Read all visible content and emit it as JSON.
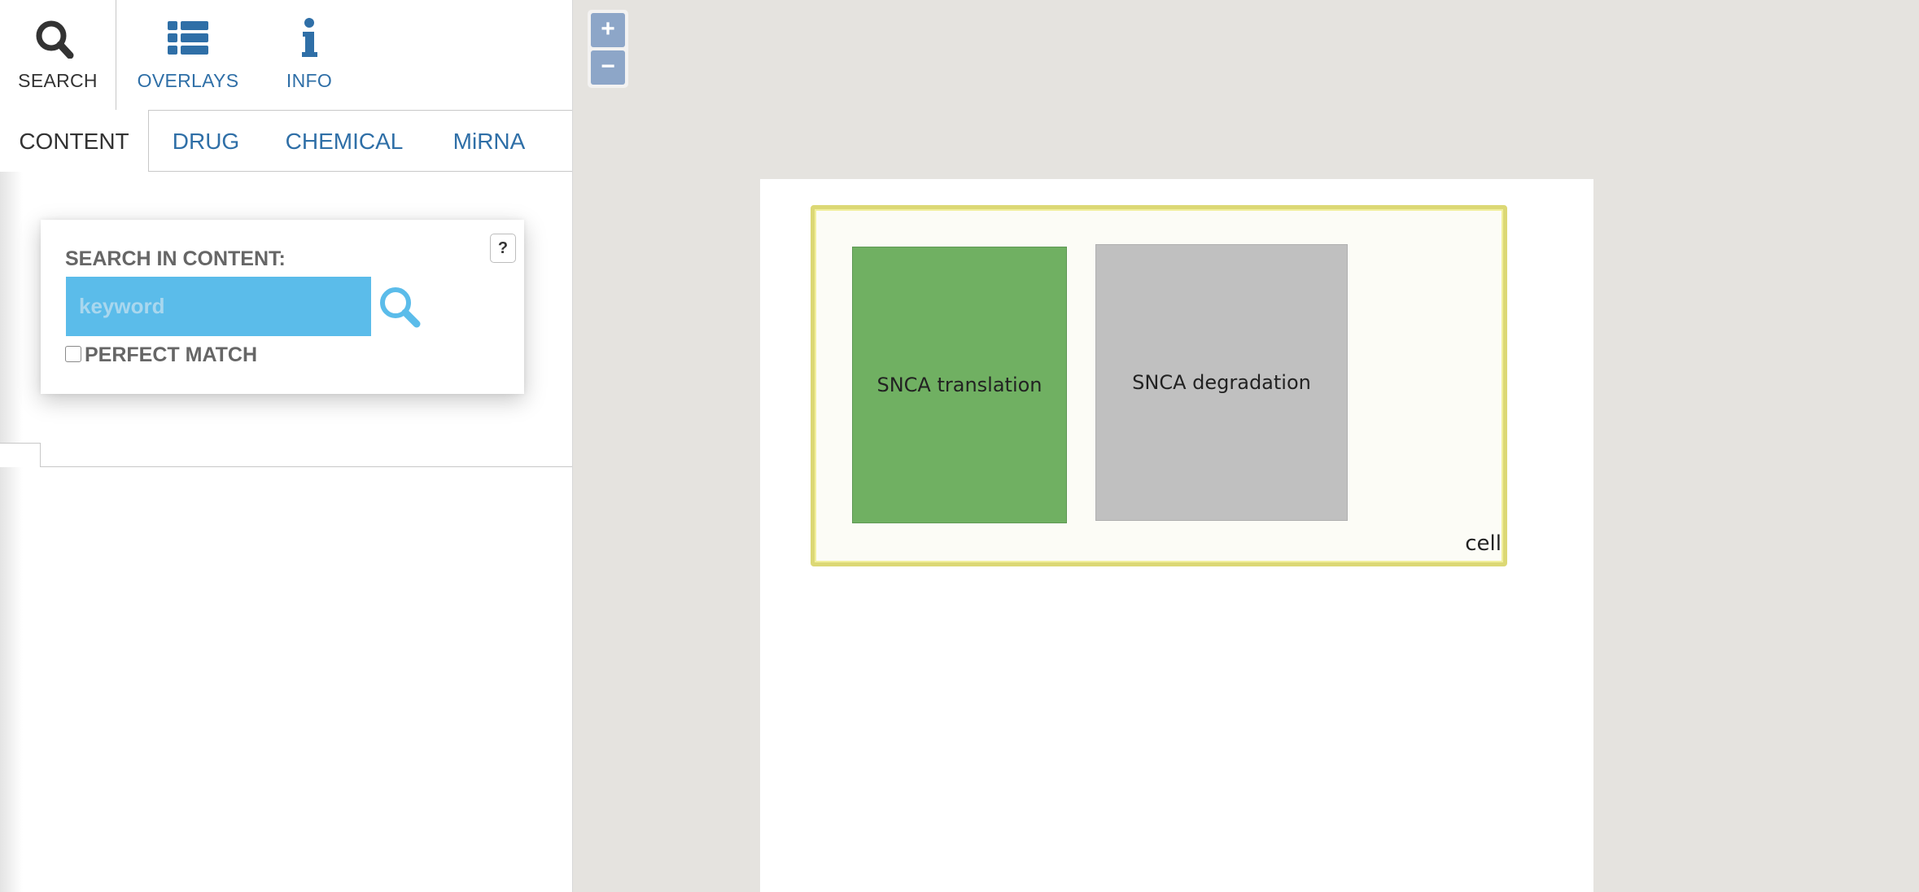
{
  "sidebar": {
    "main_tabs": [
      {
        "label": "SEARCH",
        "icon": "search-icon",
        "active": true
      },
      {
        "label": "OVERLAYS",
        "icon": "list-icon",
        "active": false
      },
      {
        "label": "INFO",
        "icon": "info-icon",
        "active": false
      }
    ],
    "sub_tabs": [
      {
        "label": "CONTENT",
        "active": true
      },
      {
        "label": "DRUG",
        "active": false
      },
      {
        "label": "CHEMICAL",
        "active": false
      },
      {
        "label": "MiRNA",
        "active": false
      }
    ],
    "search_card": {
      "title": "SEARCH IN CONTENT:",
      "help_label": "?",
      "input_value": "",
      "input_placeholder": "keyword",
      "perfect_match_label": "PERFECT MATCH",
      "perfect_match_checked": false
    }
  },
  "map": {
    "zoom_in_label": "+",
    "zoom_out_label": "−",
    "compartment_label": "cell",
    "processes": [
      {
        "label": "SNCA translation",
        "color": "#70b062"
      },
      {
        "label": "SNCA degradation",
        "color": "#c0c0c0"
      }
    ]
  },
  "colors": {
    "link_blue": "#2f6fa7",
    "search_input_bg": "#5bbcea",
    "compartment_border": "#dcd875",
    "map_background": "#e5e3df"
  }
}
